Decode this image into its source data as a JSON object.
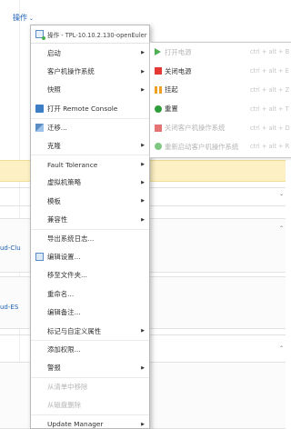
{
  "toolbar": {
    "actions_label": "操作"
  },
  "background": {
    "left_link_1": "ud-Clu",
    "left_link_2": "ud-ES"
  },
  "menu": {
    "header": "操作 - TPL-10.10.2.130-openEuler",
    "items": [
      {
        "label": "启动",
        "submenu": true,
        "disabled": false
      },
      {
        "label": "客户机操作系统",
        "submenu": true,
        "disabled": false
      },
      {
        "label": "快照",
        "submenu": true,
        "disabled": false
      },
      {
        "label": "打开 Remote Console",
        "submenu": false,
        "disabled": false,
        "icon": "remote-console-icon"
      },
      {
        "label": "迁移...",
        "submenu": false,
        "disabled": false,
        "icon": "migrate-icon"
      },
      {
        "label": "克隆",
        "submenu": true,
        "disabled": false
      },
      {
        "label": "Fault Tolerance",
        "submenu": true,
        "disabled": false
      },
      {
        "label": "虚拟机策略",
        "submenu": true,
        "disabled": false
      },
      {
        "label": "模板",
        "submenu": true,
        "disabled": false
      },
      {
        "label": "兼容性",
        "submenu": true,
        "disabled": false
      },
      {
        "label": "导出系统日志...",
        "submenu": false,
        "disabled": false
      },
      {
        "label": "编辑设置...",
        "submenu": false,
        "disabled": false,
        "icon": "edit-settings-icon"
      },
      {
        "label": "移至文件夹...",
        "submenu": false,
        "disabled": false
      },
      {
        "label": "重命名...",
        "submenu": false,
        "disabled": false
      },
      {
        "label": "编辑备注...",
        "submenu": false,
        "disabled": false
      },
      {
        "label": "标记与自定义属性",
        "submenu": true,
        "disabled": false
      },
      {
        "label": "添加权限...",
        "submenu": false,
        "disabled": false
      },
      {
        "label": "警报",
        "submenu": true,
        "disabled": false
      },
      {
        "label": "从清单中移除",
        "submenu": false,
        "disabled": true
      },
      {
        "label": "从磁盘删除",
        "submenu": false,
        "disabled": true
      },
      {
        "label": "Update Manager",
        "submenu": true,
        "disabled": false
      }
    ]
  },
  "power_submenu": {
    "items": [
      {
        "label": "打开电源",
        "shortcut": "ctrl + alt + B",
        "disabled": true,
        "icon": "power-on-icon",
        "color": "#4caf50"
      },
      {
        "label": "关闭电源",
        "shortcut": "ctrl + alt + E",
        "disabled": false,
        "icon": "power-off-icon",
        "color": "#e53935"
      },
      {
        "label": "挂起",
        "shortcut": "ctrl + alt + Z",
        "disabled": false,
        "icon": "suspend-icon",
        "color": "#f0a020"
      },
      {
        "label": "重置",
        "shortcut": "ctrl + alt + T",
        "disabled": false,
        "icon": "reset-icon",
        "color": "#2e9d3a"
      },
      {
        "label": "关闭客户机操作系统",
        "shortcut": "ctrl + alt + D",
        "disabled": true,
        "icon": "shutdown-guest-icon",
        "color": "#e57373"
      },
      {
        "label": "重新启动客户机操作系统",
        "shortcut": "ctrl + alt + R",
        "disabled": true,
        "icon": "restart-guest-icon",
        "color": "#81c784"
      }
    ]
  }
}
